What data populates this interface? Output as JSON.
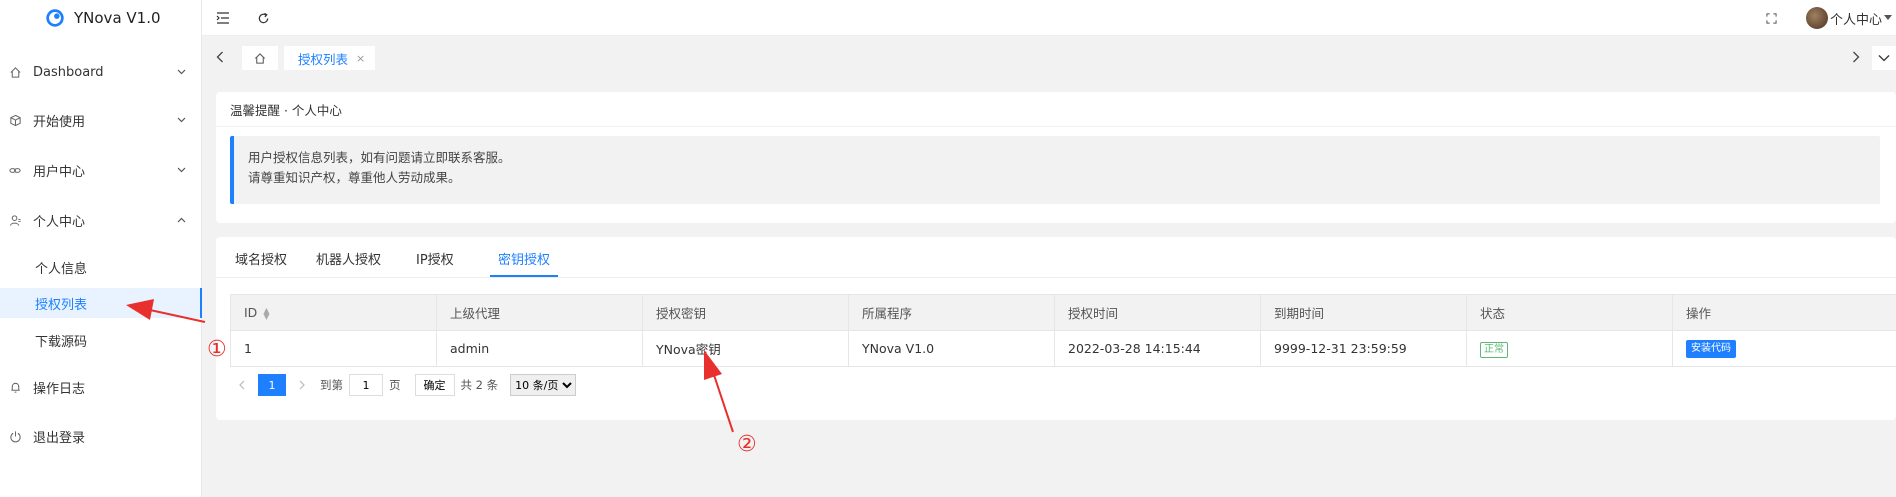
{
  "app": {
    "title": "YNova V1.0"
  },
  "sidebar": {
    "items": [
      {
        "label": "Dashboard",
        "icon": "home-icon"
      },
      {
        "label": "开始使用",
        "icon": "cube-icon"
      },
      {
        "label": "用户中心",
        "icon": "link-icon"
      },
      {
        "label": "个人中心",
        "icon": "user-icon"
      },
      {
        "label": "操作日志",
        "icon": "bell-icon"
      },
      {
        "label": "退出登录",
        "icon": "power-icon"
      }
    ],
    "sub_items": [
      {
        "label": "个人信息"
      },
      {
        "label": "授权列表"
      },
      {
        "label": "下载源码"
      }
    ]
  },
  "header": {
    "user_name": "个人中心"
  },
  "tabbar": {
    "active_tab": "授权列表",
    "close_glyph": "×"
  },
  "notice": {
    "title": "温馨提醒 · 个人中心",
    "line1": "用户授权信息列表，如有问题请立即联系客服。",
    "line2": "请尊重知识产权，尊重他人劳动成果。"
  },
  "tabs": [
    {
      "label": "域名授权"
    },
    {
      "label": "机器人授权"
    },
    {
      "label": "IP授权"
    },
    {
      "label": "密钥授权"
    }
  ],
  "table": {
    "columns": [
      "ID",
      "上级代理",
      "授权密钥",
      "所属程序",
      "授权时间",
      "到期时间",
      "状态",
      "操作"
    ],
    "rows": [
      {
        "id": "1",
        "agent": "admin",
        "key": "YNova密钥",
        "program": "YNova V1.0",
        "auth_time": "2022-03-28 14:15:44",
        "expire_time": "9999-12-31 23:59:59",
        "status": "正常",
        "action": "安装代码"
      }
    ]
  },
  "pager": {
    "current_page": "1",
    "goto_label": "到第",
    "goto_value": "1",
    "page_unit": "页",
    "confirm_label": "确定",
    "total_label": "共 2 条",
    "page_size": "10 条/页"
  },
  "annotations": {
    "one": "①",
    "two": "②"
  },
  "colors": {
    "accent": "#1e80ff",
    "success": "#5fb878",
    "annotation": "#e8302e"
  }
}
